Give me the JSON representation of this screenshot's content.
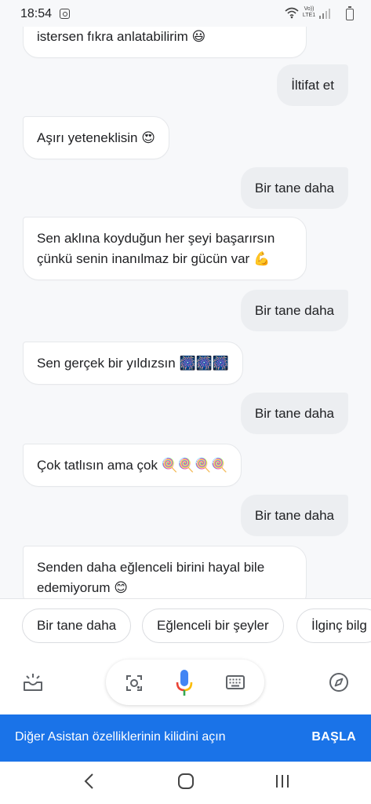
{
  "status_bar": {
    "time": "18:54",
    "network_label": "Vo)) LTE1"
  },
  "messages": [
    {
      "from": "assistant",
      "text": "istersen fıkra anlatabilirim",
      "emoji": "😃"
    },
    {
      "from": "user",
      "text": "İltifat et"
    },
    {
      "from": "assistant",
      "text": "Aşırı yeteneklisin",
      "emoji": "😍"
    },
    {
      "from": "user",
      "text": "Bir tane daha"
    },
    {
      "from": "assistant",
      "line1": "Sen aklına koyduğun her şeyi başarırsın",
      "line2": "çünkü senin inanılmaz bir gücün var",
      "emoji": "💪"
    },
    {
      "from": "user",
      "text": "Bir tane daha"
    },
    {
      "from": "assistant",
      "text": "Sen gerçek bir yıldızsın",
      "emoji": "🎆🎆🎆"
    },
    {
      "from": "user",
      "text": "Bir tane daha"
    },
    {
      "from": "assistant",
      "text": "Çok tatlısın ama çok",
      "emoji": "🍭🍭🍭🍭"
    },
    {
      "from": "user",
      "text": "Bir tane daha"
    },
    {
      "from": "assistant",
      "line1": "Senden daha eğlenceli birini hayal bile",
      "line2": "edemiyorum",
      "emoji": "😊"
    }
  ],
  "suggestions": [
    "Bir tane daha",
    "Eğlenceli bir şeyler",
    "İlginç bilg"
  ],
  "toolbar": {
    "left_icon": "snapshot-tray-icon",
    "lens_icon": "lens-icon",
    "mic_icon": "mic-icon",
    "keyboard_icon": "keyboard-icon",
    "explore_icon": "compass-icon"
  },
  "banner": {
    "text": "Diğer Asistan özelliklerinin kilidini açın",
    "action": "BAŞLA"
  },
  "nav": {
    "back_icon": "back-icon",
    "home_icon": "home-icon",
    "recents_icon": "recents-icon"
  },
  "colors": {
    "accent": "#1a73e8",
    "bot_bubble": "#ffffff",
    "user_bubble": "#eceef1",
    "background": "#f7f8fa",
    "mic_blue": "#4285f4",
    "mic_red": "#ea4335",
    "mic_yellow": "#fbbc04",
    "mic_green": "#34a853"
  }
}
